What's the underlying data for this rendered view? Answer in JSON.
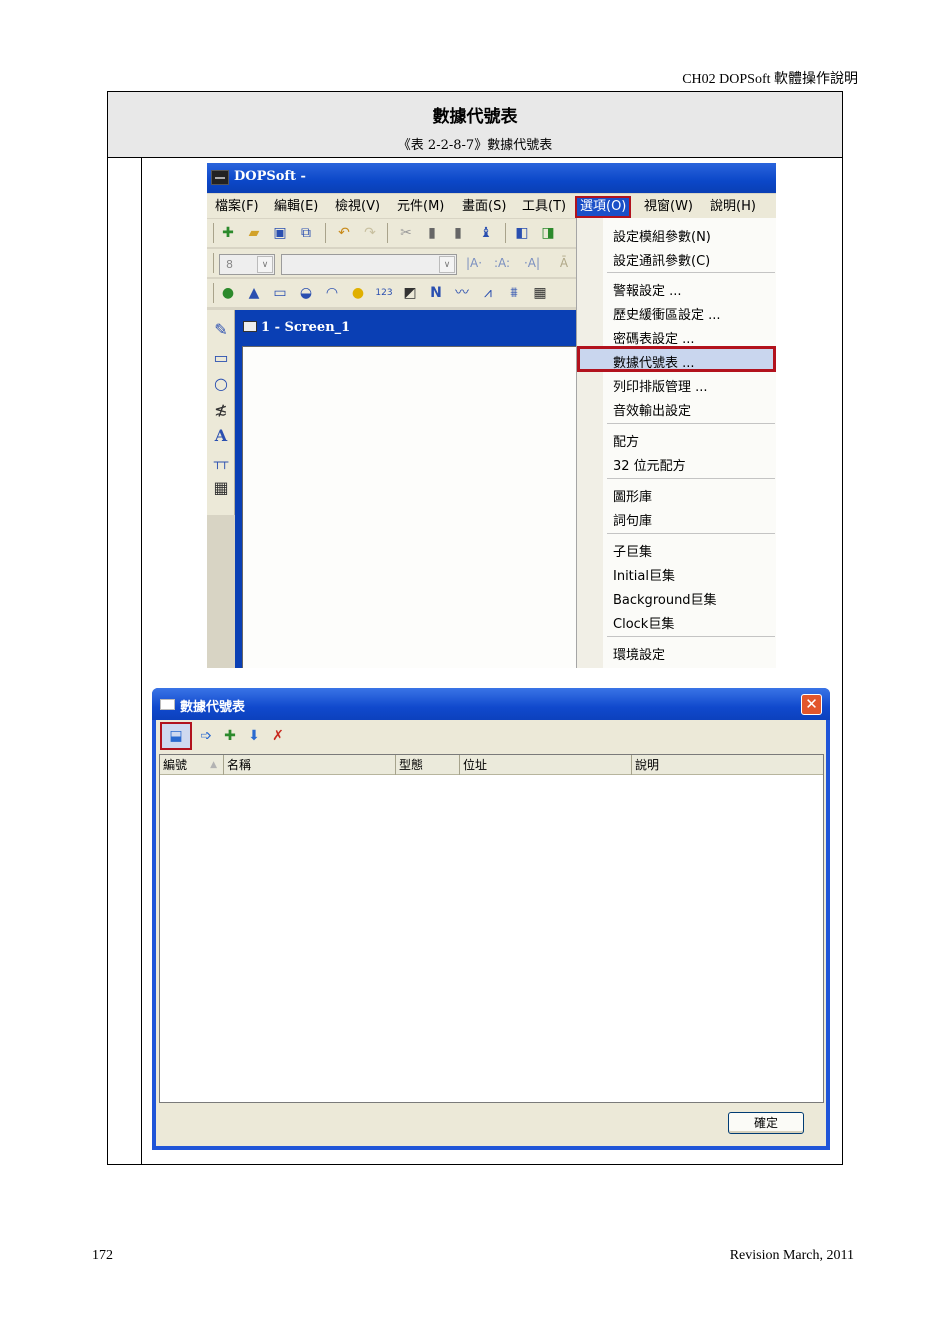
{
  "page": {
    "header": "CH02 DOPSoft 軟體操作說明",
    "number": "172",
    "revision": "Revision March, 2011"
  },
  "table": {
    "title": "數據代號表",
    "caption": "《表 2-2-8-7》數據代號表"
  },
  "app": {
    "title": "DOPSoft -",
    "menu": [
      "檔案(F)",
      "編輯(E)",
      "檢視(V)",
      "元件(M)",
      "畫面(S)",
      "工具(T)",
      "選項(O)",
      "視窗(W)",
      "說明(H)"
    ],
    "font_size_value": "8",
    "mdi_title": "1 - Screen_1",
    "options_menu": [
      "設定模組參數(N)",
      "設定通訊參數(C)",
      "警報設定 ...",
      "歷史緩衝區設定 ...",
      "密碼表設定 ...",
      "數據代號表 ...",
      "列印排版管理 ...",
      "音效輸出設定",
      "配方",
      "32 位元配方",
      "圖形庫",
      "詞句庫",
      "子巨集",
      "Initial巨集",
      "Background巨集",
      "Clock巨集",
      "環境設定"
    ]
  },
  "dialog": {
    "title": "數據代號表",
    "columns": [
      "編號",
      "名稱",
      "型態",
      "位址",
      "說明"
    ],
    "ok": "確定"
  },
  "colors": {
    "highlight_border": "#b2121d",
    "xp_blue": "#0b47c8"
  }
}
